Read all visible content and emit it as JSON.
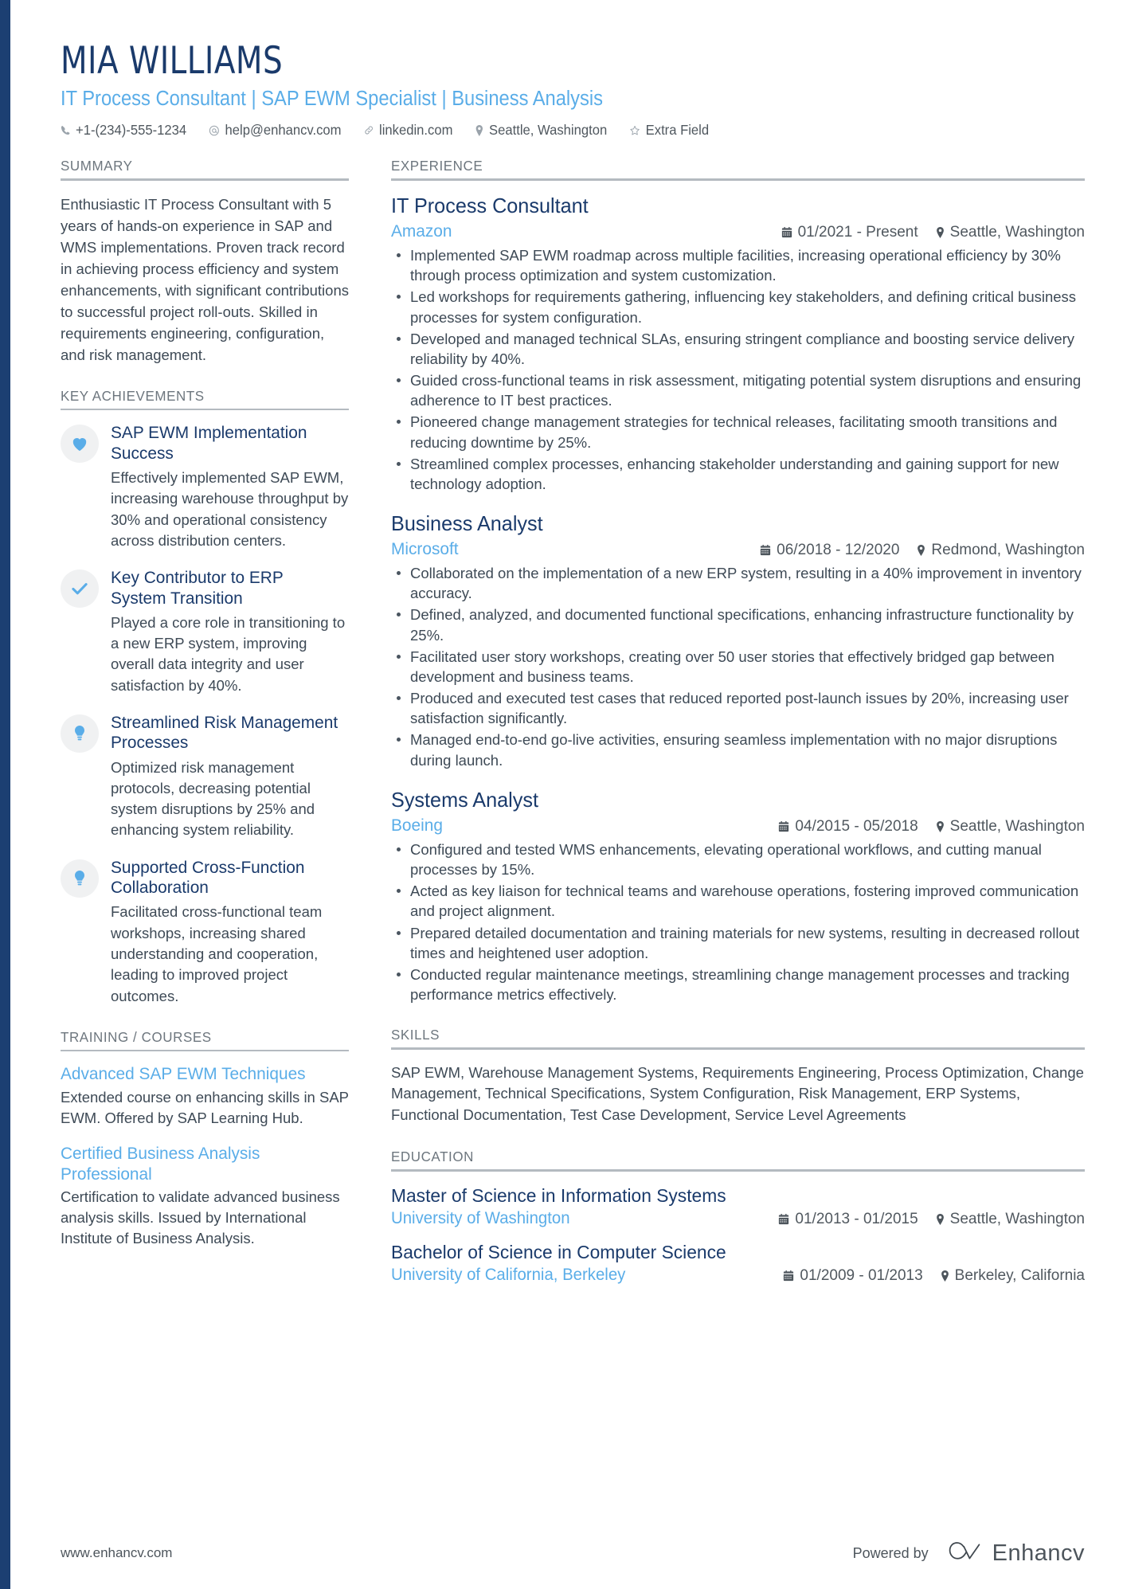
{
  "header": {
    "name": "MIA WILLIAMS",
    "headline": "IT Process Consultant | SAP EWM Specialist | Business Analysis",
    "contacts": [
      {
        "icon": "phone-icon",
        "text": "+1-(234)-555-1234"
      },
      {
        "icon": "email-icon",
        "text": "help@enhancv.com"
      },
      {
        "icon": "link-icon",
        "text": "linkedin.com"
      },
      {
        "icon": "location-pin-icon",
        "text": "Seattle, Washington"
      },
      {
        "icon": "star-icon",
        "text": "Extra Field"
      }
    ]
  },
  "sections": {
    "summary_title": "SUMMARY",
    "key_achievements_title": "KEY ACHIEVEMENTS",
    "training_title": "TRAINING / COURSES",
    "experience_title": "EXPERIENCE",
    "skills_title": "SKILLS",
    "education_title": "EDUCATION"
  },
  "summary": {
    "text": "Enthusiastic IT Process Consultant with 5 years of hands-on experience in SAP and WMS implementations. Proven track record in achieving process efficiency and system enhancements, with significant contributions to successful project roll-outs. Skilled in requirements engineering, configuration, and risk management."
  },
  "key_achievements": [
    {
      "icon": "heart-icon",
      "title": "SAP EWM Implementation Success",
      "description": "Effectively implemented SAP EWM, increasing warehouse throughput by 30% and operational consistency across distribution centers."
    },
    {
      "icon": "check-icon",
      "title": "Key Contributor to ERP System Transition",
      "description": "Played a core role in transitioning to a new ERP system, improving overall data integrity and user satisfaction by 40%."
    },
    {
      "icon": "lightbulb-icon",
      "title": "Streamlined Risk Management Processes",
      "description": "Optimized risk management protocols, decreasing potential system disruptions by 25% and enhancing system reliability."
    },
    {
      "icon": "lightbulb-icon",
      "title": "Supported Cross-Function Collaboration",
      "description": "Facilitated cross-functional team workshops, increasing shared understanding and cooperation, leading to improved project outcomes."
    }
  ],
  "training": [
    {
      "title": "Advanced SAP EWM Techniques",
      "description": "Extended course on enhancing skills in SAP EWM. Offered by SAP Learning Hub."
    },
    {
      "title": "Certified Business Analysis Professional",
      "description": "Certification to validate advanced business analysis skills. Issued by International Institute of Business Analysis."
    }
  ],
  "experience": [
    {
      "title": "IT Process Consultant",
      "company": "Amazon",
      "date": "01/2021 - Present",
      "location": "Seattle, Washington",
      "bullets": [
        "Implemented SAP EWM roadmap across multiple facilities, increasing operational efficiency by 30% through process optimization and system customization.",
        "Led workshops for requirements gathering, influencing key stakeholders, and defining critical business processes for system configuration.",
        "Developed and managed technical SLAs, ensuring stringent compliance and boosting service delivery reliability by 40%.",
        "Guided cross-functional teams in risk assessment, mitigating potential system disruptions and ensuring adherence to IT best practices.",
        "Pioneered change management strategies for technical releases, facilitating smooth transitions and reducing downtime by 25%.",
        "Streamlined complex processes, enhancing stakeholder understanding and gaining support for new technology adoption."
      ]
    },
    {
      "title": "Business Analyst",
      "company": "Microsoft",
      "date": "06/2018 - 12/2020",
      "location": "Redmond, Washington",
      "bullets": [
        "Collaborated on the implementation of a new ERP system, resulting in a 40% improvement in inventory accuracy.",
        "Defined, analyzed, and documented functional specifications, enhancing infrastructure functionality by 25%.",
        "Facilitated user story workshops, creating over 50 user stories that effectively bridged gap between development and business teams.",
        "Produced and executed test cases that reduced reported post-launch issues by 20%, increasing user satisfaction significantly.",
        "Managed end-to-end go-live activities, ensuring seamless implementation with no major disruptions during launch."
      ]
    },
    {
      "title": "Systems Analyst",
      "company": "Boeing",
      "date": "04/2015 - 05/2018",
      "location": "Seattle, Washington",
      "bullets": [
        "Configured and tested WMS enhancements, elevating operational workflows, and cutting manual processes by 15%.",
        "Acted as key liaison for technical teams and warehouse operations, fostering improved communication and project alignment.",
        "Prepared detailed documentation and training materials for new systems, resulting in decreased rollout times and heightened user adoption.",
        "Conducted regular maintenance meetings, streamlining change management processes and tracking performance metrics effectively."
      ]
    }
  ],
  "skills": {
    "text": "SAP EWM, Warehouse Management Systems, Requirements Engineering, Process Optimization, Change Management, Technical Specifications, System Configuration, Risk Management, ERP Systems, Functional Documentation, Test Case Development, Service Level Agreements"
  },
  "education": [
    {
      "degree": "Master of Science in Information Systems",
      "school": "University of Washington",
      "date": "01/2013 - 01/2015",
      "location": "Seattle, Washington"
    },
    {
      "degree": "Bachelor of Science in Computer Science",
      "school": "University of California, Berkeley",
      "date": "01/2009 - 01/2013",
      "location": "Berkeley, California"
    }
  ],
  "footer": {
    "url": "www.enhancv.com",
    "powered_by": "Powered by",
    "brand": "Enhancv"
  },
  "colors": {
    "accent_dark_blue": "#1a3a6b",
    "accent_light_blue": "#5aade8",
    "sidebar_bar": "#1c3f72",
    "body_text": "#3e4a56",
    "rule": "#b4bac0"
  }
}
